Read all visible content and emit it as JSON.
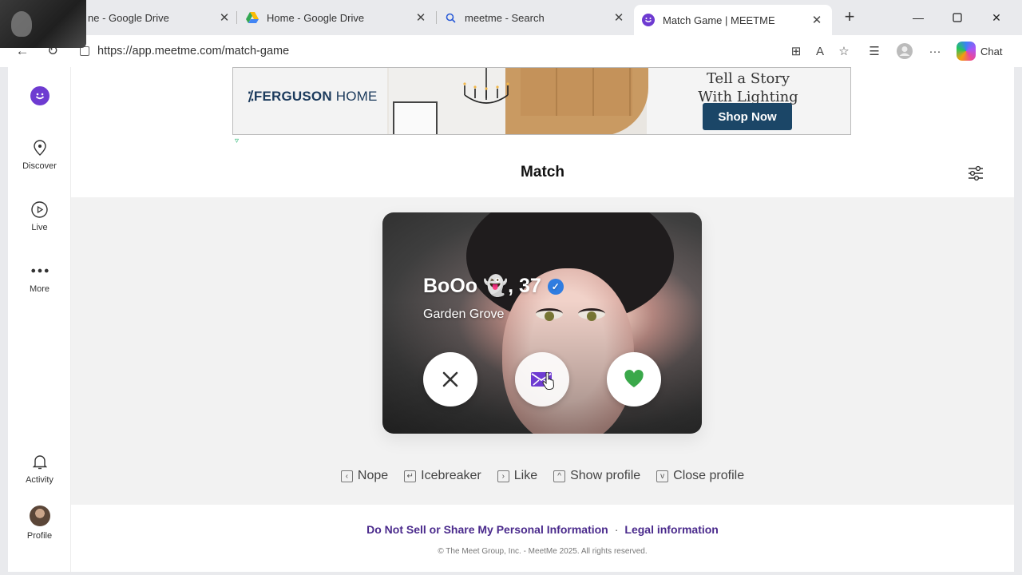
{
  "browser": {
    "tabs": [
      {
        "title": "ne - Google Drive",
        "active": false
      },
      {
        "title": "Home - Google Drive",
        "active": false
      },
      {
        "title": "meetme - Search",
        "active": false
      },
      {
        "title": "Match Game | MEETME",
        "active": true
      }
    ],
    "url": "https://app.meetme.com/match-game",
    "chat_label": "Chat"
  },
  "sidebar": {
    "items": [
      {
        "label": "Discover",
        "icon": "location-pin-icon"
      },
      {
        "label": "Live",
        "icon": "play-circle-icon"
      },
      {
        "label": "More",
        "icon": "more-dots-icon"
      },
      {
        "label": "Activity",
        "icon": "bell-icon"
      },
      {
        "label": "Profile",
        "icon": "avatar"
      }
    ]
  },
  "ad": {
    "brand": "FERGUSON",
    "brand_suffix": "HOME",
    "headline_line1": "Tell a Story",
    "headline_line2": "With Lighting",
    "cta": "Shop Now"
  },
  "match": {
    "title": "Match",
    "card": {
      "name": "BoOo 👻",
      "age": ", 37",
      "city": "Garden Grove",
      "verified": true
    },
    "shortcuts": [
      {
        "key": "‹",
        "label": "Nope"
      },
      {
        "key": "↵",
        "label": "Icebreaker"
      },
      {
        "key": "›",
        "label": "Like"
      },
      {
        "key": "^",
        "label": "Show profile"
      },
      {
        "key": "v",
        "label": "Close profile"
      }
    ]
  },
  "footer": {
    "link1": "Do Not Sell or Share My Personal Information",
    "link2": "Legal information",
    "copyright": "© The Meet Group, Inc. - MeetMe 2025. All rights reserved."
  },
  "colors": {
    "brand_purple": "#6e3bd1",
    "like_green": "#3aa84a",
    "verified_blue": "#2f7de1",
    "ad_button": "#1b4667"
  }
}
